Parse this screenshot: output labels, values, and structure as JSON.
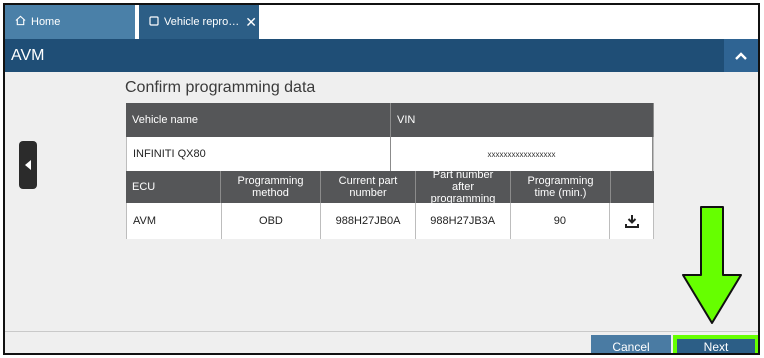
{
  "tabs": {
    "home_label": "Home",
    "vehicle_label": "Vehicle repro…"
  },
  "titlebar": {
    "title": "AVM"
  },
  "section": {
    "title": "Confirm programming data"
  },
  "vehicle_table": {
    "headers": {
      "name": "Vehicle name",
      "vin": "VIN"
    },
    "row": {
      "name": "INFINITI QX80",
      "vin": "xxxxxxxxxxxxxxxxx"
    }
  },
  "ecu_table": {
    "headers": {
      "ecu": "ECU",
      "method": "Programming method",
      "current": "Current part number",
      "after": "Part number after programming",
      "time": "Programming time (min.)"
    },
    "row": {
      "ecu": "AVM",
      "method": "OBD",
      "current": "988H27JB0A",
      "after": "988H27JB3A",
      "time": "90"
    }
  },
  "footer": {
    "cancel_label": "Cancel",
    "next_label": "Next"
  },
  "colors": {
    "tab_home": "#4a80a8",
    "tab_active": "#2c5e86",
    "titlebar": "#1f4e76",
    "table_header": "#555658",
    "highlight": "#66ff00"
  },
  "icons": [
    "home-icon",
    "window-icon",
    "close-icon",
    "chevron-up-icon",
    "chevron-left-icon",
    "download-icon",
    "down-arrow-annotation"
  ]
}
